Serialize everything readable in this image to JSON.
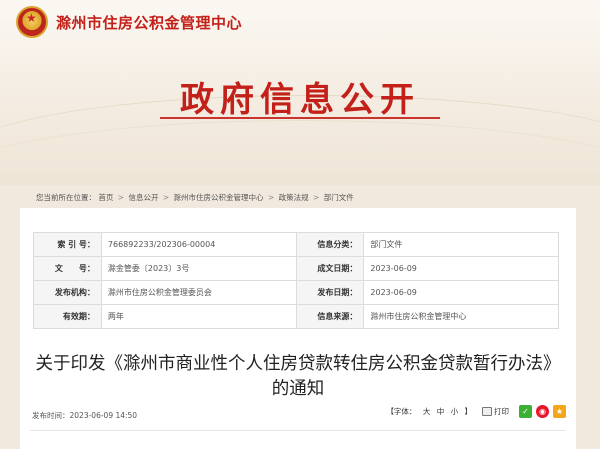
{
  "header": {
    "site_name": "滁州市住房公积金管理中心",
    "section_title": "政府信息公开"
  },
  "breadcrumb": {
    "prefix": "您当前所在位置：",
    "items": [
      "首页",
      "信息公开",
      "滁州市住房公积金管理中心",
      "政策法规",
      "部门文件"
    ],
    "separator": ">"
  },
  "info": {
    "index_label": "索 引 号：",
    "index_value": "766892233/202306-00004",
    "category_label": "信息分类：",
    "category_value": "部门文件",
    "doc_no_label": "文　　号：",
    "doc_no_value": "滁金管委〔2023〕3号",
    "date_label": "成文日期：",
    "date_value": "2023-06-09",
    "issuer_label": "发布机构：",
    "issuer_value": "滁州市住房公积金管理委员会",
    "publish_label": "发布日期：",
    "publish_value": "2023-06-09",
    "validity_label": "有效期：",
    "validity_value": "两年",
    "source_label": "信息来源：",
    "source_value": "滁州市住房公积金管理中心"
  },
  "document": {
    "title": "关于印发《滁州市商业性个人住房贷款转住房公积金贷款暂行办法》的通知",
    "publish_time": "发布时间：2023-06-09 14:50"
  },
  "tools": {
    "font_prefix": "【字体：",
    "font_large": "大",
    "font_medium": "中",
    "font_small": "小",
    "font_suffix": "】",
    "print_label": "打印"
  },
  "icons": {
    "emblem": "national-emblem-icon",
    "print": "printer-icon",
    "wechat": "wechat-icon",
    "weibo": "weibo-icon",
    "qzone": "qzone-icon"
  },
  "colors": {
    "brand_red": "#c4201a",
    "background": "#f1e9de"
  }
}
